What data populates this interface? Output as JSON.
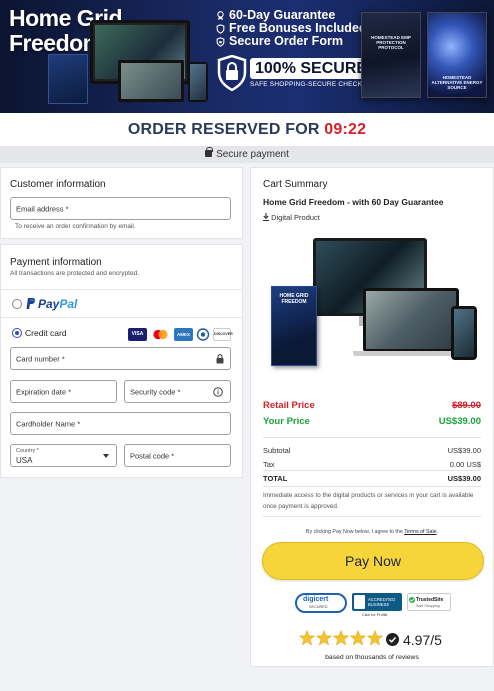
{
  "banner": {
    "brand_line1": "Home Grid",
    "brand_line2": "Freedom",
    "bullets": [
      "60-Day Guarantee",
      "Free Bonuses Included",
      "Secure Order Form"
    ],
    "secure_main": "100% SECURE",
    "secure_sub": "SAFE SHOPPING-SECURE CHECKOUTS",
    "bookA_title": "HOMESTEAD EMP PROTECTION PROTOCOL",
    "bookB_title": "HOMESTEAD ALTERNATIVE ENERGY SOURCE",
    "ebook_title": "HOME GRID FREEDOM"
  },
  "reserved": {
    "label": "ORDER RESERVED FOR",
    "timer": "09:22"
  },
  "secure_bar": {
    "label": "Secure payment"
  },
  "customer": {
    "title": "Customer information",
    "email_label": "Email address *",
    "email_help": "To receive an order confirmation by email."
  },
  "payment": {
    "title": "Payment information",
    "subtitle": "All transactions are protected and encrypted.",
    "paypal_pay": "Pay",
    "paypal_pal": "Pal",
    "credit_label": "Credit card",
    "card_logos": [
      "VISA",
      "MC",
      "AMEX",
      "DC",
      "DISCOVER"
    ],
    "card_number": "Card number *",
    "expiration": "Expiration date *",
    "security_code": "Security code *",
    "cardholder": "Cardholder Name *",
    "country_label": "Country *",
    "country_value": "USA",
    "postal": "Postal code *"
  },
  "cart": {
    "title": "Cart Summary",
    "product": "Home Grid Freedom - with 60 Day Guarantee",
    "product_type": "Digital Product",
    "retail_label": "Retail Price",
    "retail_value": "$89.00",
    "your_label": "Your Price",
    "your_value": "US$39.00",
    "subtotal_label": "Subtotal",
    "subtotal_value": "US$39.00",
    "tax_label": "Tax",
    "tax_value": "0.00 US$",
    "total_label": "TOTAL",
    "total_value": "US$39.00",
    "access_note": "Immediate access to the digital products or services in your cart is available once payment is approved.",
    "terms_pre": "By clicking Pay Now below, I agree to the",
    "terms_link": "Terms of Sale",
    "terms_post": ".",
    "pay_button": "Pay Now",
    "digicert": "digicert",
    "digicert_sub": "SECURED",
    "bbb_line1": "ACCREDITED",
    "bbb_line2": "BUSINESS",
    "bbb_sub": "Click for Profile",
    "trusted": "TrustedSite",
    "trusted_sub": "Safe Shopping",
    "rating": "4.97/5",
    "rating_stars": 5,
    "rating_note": "based on thousands of reviews"
  },
  "colors": {
    "accent_red": "#d6202a",
    "accent_green": "#19a23b",
    "pay_yellow": "#f7d43a",
    "brand_navy": "#1b2e72"
  }
}
